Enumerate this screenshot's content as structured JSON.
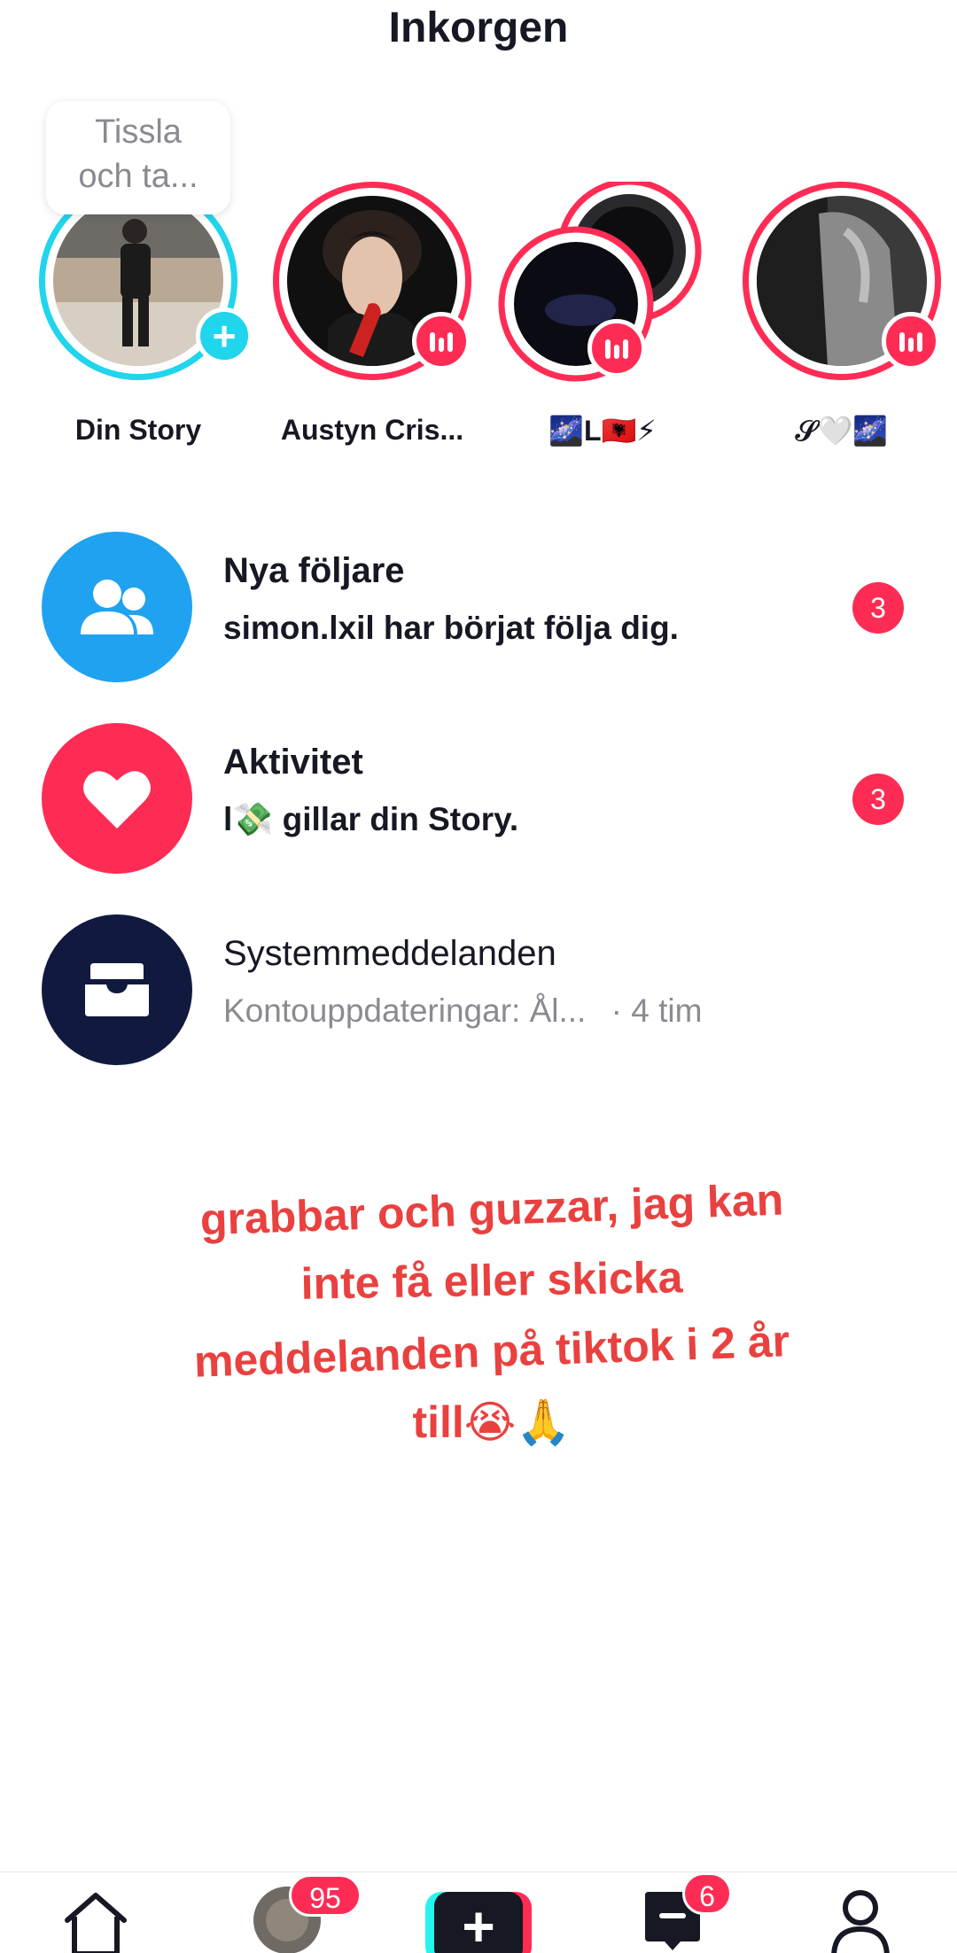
{
  "header": {
    "title": "Inkorgen"
  },
  "stories": {
    "tooltip": "Tissla\noch ta...",
    "items": [
      {
        "name": "Din Story"
      },
      {
        "name": "Austyn Cris..."
      },
      {
        "name": "🌌L🇦🇱⚡"
      },
      {
        "name": "𝒮🤍🌌"
      }
    ]
  },
  "inbox": [
    {
      "title": "Nya följare",
      "subtitle": "simon.lxil har börjat följa dig.",
      "count": "3",
      "icon": "followers-icon",
      "color": "#1fa2f0"
    },
    {
      "title": "Aktivitet",
      "subtitle": "l💸 gillar din Story.",
      "count": "3",
      "icon": "heart-icon",
      "color": "#fe2c55"
    },
    {
      "title": "Systemmeddelanden",
      "subtitle": "Kontouppdateringar: Ål...",
      "time": "· 4 tim",
      "icon": "inbox-tray-icon",
      "color": "#111a3e"
    }
  ],
  "caption": {
    "line1": "grabbar och guzzar, jag kan",
    "line2": "inte få eller skicka",
    "line3": "meddelanden på tiktok i 2 år",
    "line4": "till😭🙏"
  },
  "nav": {
    "friends_badge": "95",
    "inbox_badge": "6"
  },
  "colors": {
    "accent_pink": "#fe2c55",
    "accent_cyan": "#20d5ec",
    "caption_red": "#e9413f",
    "text_dark": "#161823",
    "text_muted": "#8a8b91"
  }
}
